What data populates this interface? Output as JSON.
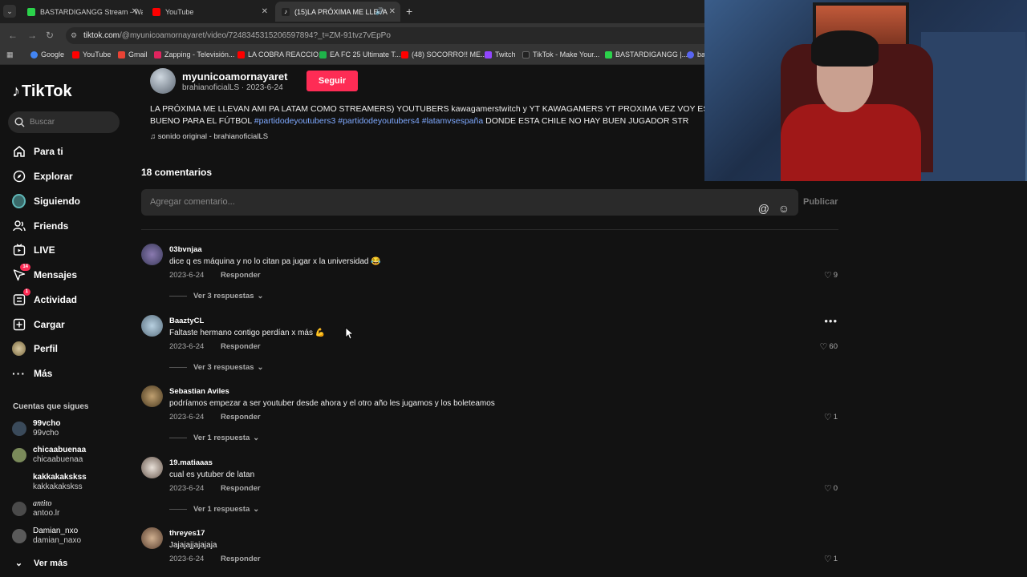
{
  "browser": {
    "tabs": [
      {
        "title": "BASTARDIGANGG Stream - Wat",
        "color": "#2bd24b"
      },
      {
        "title": "YouTube",
        "color": "#ff0000"
      },
      {
        "title": "(15)LA PRÓXIMA ME LLEVA",
        "color": "#ffffff"
      }
    ],
    "url_domain": "tiktok.com",
    "url_path": "/@myunicoamornayaret/video/7248345315206597894?_t=ZM-91tvz7vEpPo",
    "bookmarks": [
      "Google",
      "YouTube",
      "Gmail",
      "Zapping - Televisión...",
      "LA COBRA REACCIO...",
      "EA FC 25 Ultimate T...",
      "(48) SOCORRO!! ME...",
      "Twitch",
      "TikTok - Make Your...",
      "BASTARDIGANGG |...",
      "ba"
    ]
  },
  "sidebar": {
    "logo": "TikTok",
    "search_placeholder": "Buscar",
    "items": [
      {
        "label": "Para ti",
        "icon": "home-icon"
      },
      {
        "label": "Explorar",
        "icon": "compass-icon"
      },
      {
        "label": "Siguiendo",
        "icon": "following-icon"
      },
      {
        "label": "Friends",
        "icon": "friends-icon"
      },
      {
        "label": "LIVE",
        "icon": "live-icon"
      },
      {
        "label": "Mensajes",
        "icon": "messages-icon",
        "badge": "14"
      },
      {
        "label": "Actividad",
        "icon": "activity-icon",
        "badge": "1"
      },
      {
        "label": "Cargar",
        "icon": "upload-icon"
      },
      {
        "label": "Perfil",
        "icon": "profile-icon"
      },
      {
        "label": "Más",
        "icon": "more-icon"
      }
    ],
    "following_header": "Cuentas que sigues",
    "following": [
      {
        "name": "99vcho",
        "handle": "99vcho"
      },
      {
        "name": "chicaabuenaa",
        "handle": "chicaabuenaa"
      },
      {
        "name": "kakkakakskss",
        "handle": "kakkakakskss"
      },
      {
        "name": "antito",
        "handle": "antoo.lr"
      },
      {
        "name": "Damian_nxo",
        "handle": "damian_naxo"
      }
    ],
    "see_more": "Ver más"
  },
  "video": {
    "author": "myunicoamornayaret",
    "author_sub": "brahianoficialLS · 2023-6-24",
    "follow_label": "Seguir",
    "desc_line1": "LA PRÓXIMA ME LLEVAN AMI PA LATAM COMO STREAMERS) YOUTUBERS kawagamerstwitch y YT KAWAGAMERS YT PROXIMA VEZ VOY EST",
    "desc_line2_a": "BUENO PARA EL FÚTBOL ",
    "tag1": "#partidodeyoutubers3",
    "tag2": "#partidodeyoutubers4",
    "tag3": "#latamvsespaña",
    "desc_line2_b": " DONDE ESTA CHILE NO HAY BUEN JUGADOR STR",
    "sound": "♫ sonido original - brahianoficialLS"
  },
  "comments_section": {
    "count_label": "18 comentarios",
    "input_placeholder": "Agregar comentario...",
    "publish_label": "Publicar",
    "reply_label": "Responder",
    "comments": [
      {
        "user": "03bvnjaa",
        "text": "dice q es máquina y no lo citan pa jugar x la universidad 😂",
        "date": "2023-6-24",
        "likes": "9",
        "replies": "Ver 3 respuestas"
      },
      {
        "user": "BaaztyCL",
        "text": "Faltaste hermano contigo perdían x más 💪",
        "date": "2023-6-24",
        "likes": "60",
        "replies": "Ver 3 respuestas"
      },
      {
        "user": "Sebastian Aviles",
        "text": "podríamos empezar a ser youtuber desde ahora y el otro año les jugamos y los boleteamos",
        "date": "2023-6-24",
        "likes": "1",
        "replies": "Ver 1 respuesta"
      },
      {
        "user": "19.matiaaas",
        "text": "cual es yutuber de latan",
        "date": "2023-6-24",
        "likes": "0",
        "replies": "Ver 1 respuesta"
      },
      {
        "user": "threyes17",
        "text": "Jajajajjajajaja",
        "date": "2023-6-24",
        "likes": "1",
        "replies": ""
      }
    ]
  },
  "colors": {
    "accent": "#fe2c55",
    "link": "#7fa9ff",
    "bg": "#121212"
  }
}
